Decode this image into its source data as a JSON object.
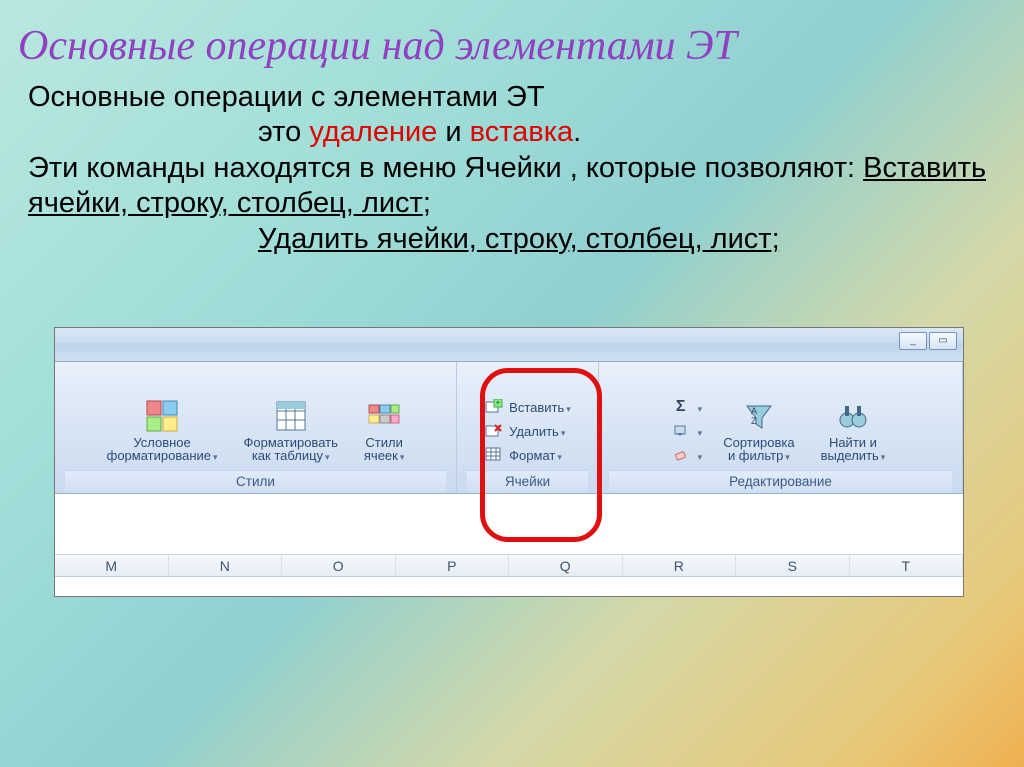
{
  "title": "Основные операции над элементами ЭТ",
  "p1a": "Основные операции  с элементами ЭТ",
  "p1b_prefix": "это ",
  "p1b_del": "удаление",
  "p1b_mid": "  и ",
  "p1b_ins": "вставка",
  "p1b_dot": ".",
  "p2": "Эти команды  находятся  в  меню  Ячейки , которые позволяют: ",
  "u1": "Вставить ячейки, строку, столбец, лист",
  "semi": ";",
  "u2": "Удалить ячейки, строку, столбец, лист;",
  "ribbon": {
    "groups": {
      "styles": {
        "label": "Стили",
        "cond_fmt": "Условное\nформатирование",
        "as_table": "Форматировать\nкак таблицу",
        "cell_styles": "Стили\nячеек"
      },
      "cells": {
        "label": "Ячейки",
        "insert": "Вставить",
        "delete": "Удалить",
        "format": "Формат"
      },
      "editing": {
        "label": "Редактирование",
        "sigma": "Σ",
        "sort": "Сортировка\nи фильтр",
        "find": "Найти и\nвыделить"
      }
    }
  },
  "columns": [
    "M",
    "N",
    "O",
    "P",
    "Q",
    "R",
    "S",
    "T"
  ],
  "win": {
    "min": "_",
    "max": "▭"
  }
}
